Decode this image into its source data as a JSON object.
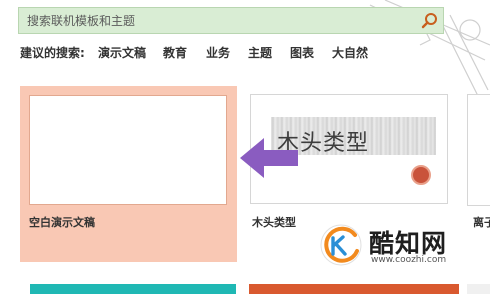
{
  "search": {
    "placeholder": "搜索联机模板和主题",
    "icon": "search-icon"
  },
  "suggestions": {
    "label": "建议的搜索:",
    "items": [
      "演示文稿",
      "教育",
      "业务",
      "主题",
      "图表",
      "大自然"
    ]
  },
  "templates": [
    {
      "label": "空白演示文稿",
      "selected": true
    },
    {
      "label": "木头类型",
      "thumb_title": "木头类型"
    },
    {
      "label": "离子"
    }
  ],
  "watermark": {
    "brand": "酷知网",
    "url": "www.coozhi.com"
  },
  "colors": {
    "search_bg": "#d9edd4",
    "selected_bg": "#f9c8b4",
    "arrow": "#8a5cc0",
    "search_icon": "#c85f1e",
    "teal_thumb": "#1fb8b4",
    "orange_thumb": "#d9592f"
  }
}
